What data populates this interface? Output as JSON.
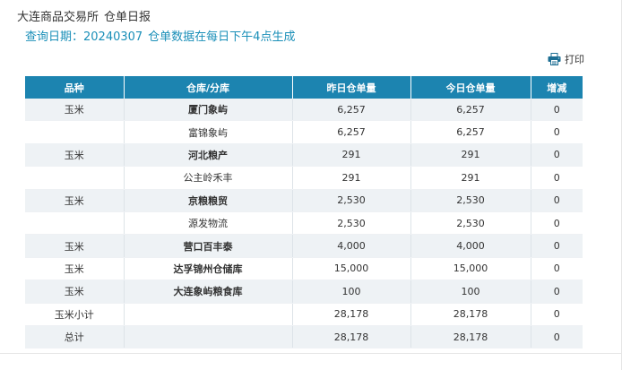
{
  "header": {
    "exchange": "大连商品交易所",
    "report_name": "仓单日报"
  },
  "query": {
    "date_label": "查询日期：20240307",
    "note": "仓单数据在每日下午4点生成"
  },
  "toolbar": {
    "print_icon": "printer-icon",
    "print_label": "打印"
  },
  "table": {
    "columns": [
      "品种",
      "仓库/分库",
      "昨日仓单量",
      "今日仓单量",
      "增减"
    ],
    "rows": [
      {
        "variety": "玉米",
        "warehouse": "厦门象屿",
        "yesterday": "6,257",
        "today": "6,257",
        "change": "0",
        "bold": true
      },
      {
        "variety": "",
        "warehouse": "富锦象屿",
        "yesterday": "6,257",
        "today": "6,257",
        "change": "0",
        "bold": false
      },
      {
        "variety": "玉米",
        "warehouse": "河北粮产",
        "yesterday": "291",
        "today": "291",
        "change": "0",
        "bold": true
      },
      {
        "variety": "",
        "warehouse": "公主岭禾丰",
        "yesterday": "291",
        "today": "291",
        "change": "0",
        "bold": false
      },
      {
        "variety": "玉米",
        "warehouse": "京粮粮贸",
        "yesterday": "2,530",
        "today": "2,530",
        "change": "0",
        "bold": true
      },
      {
        "variety": "",
        "warehouse": "源发物流",
        "yesterday": "2,530",
        "today": "2,530",
        "change": "0",
        "bold": false
      },
      {
        "variety": "玉米",
        "warehouse": "营口百丰泰",
        "yesterday": "4,000",
        "today": "4,000",
        "change": "0",
        "bold": true
      },
      {
        "variety": "玉米",
        "warehouse": "达孚锦州仓储库",
        "yesterday": "15,000",
        "today": "15,000",
        "change": "0",
        "bold": true
      },
      {
        "variety": "玉米",
        "warehouse": "大连象屿粮食库",
        "yesterday": "100",
        "today": "100",
        "change": "0",
        "bold": true
      },
      {
        "variety": "玉米小计",
        "warehouse": "",
        "yesterday": "28,178",
        "today": "28,178",
        "change": "0",
        "bold": false
      },
      {
        "variety": "总计",
        "warehouse": "",
        "yesterday": "28,178",
        "today": "28,178",
        "change": "0",
        "bold": false
      }
    ]
  }
}
